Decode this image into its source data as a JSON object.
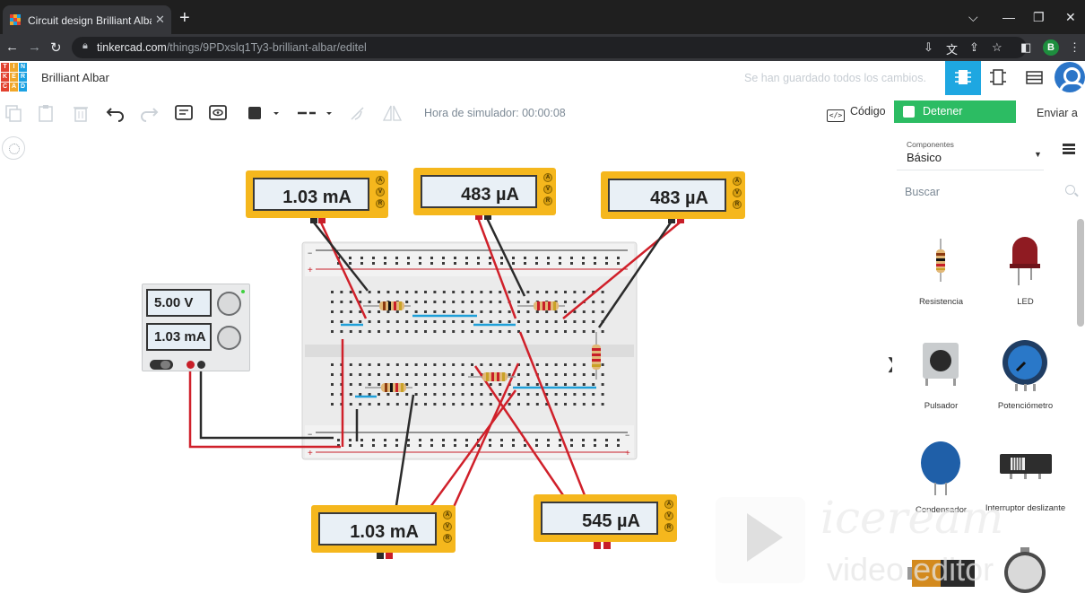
{
  "browser": {
    "tab_title": "Circuit design Brilliant Albar | Tin",
    "url_host": "tinkercad.com",
    "url_path": "/things/9PDxslq1Ty3-brilliant-albar/editel",
    "profile_initial": "B"
  },
  "header": {
    "logo_letters": [
      "T",
      "I",
      "N",
      "K",
      "E",
      "R",
      "C",
      "A",
      "D"
    ],
    "logo_colors": [
      "#e2412f",
      "#f0a72a",
      "#1ba1e2",
      "#e2412f",
      "#f0a72a",
      "#1ba1e2",
      "#e2412f",
      "#f0a72a",
      "#1ba1e2"
    ],
    "project_name": "Brilliant Albar",
    "saved_status": "Se han guardado todos los cambios."
  },
  "toolbar": {
    "sim_time": "Hora de simulador: 00:00:08",
    "code_label": "Código",
    "stop_sim_label": "Detener simulación",
    "send_label": "Enviar a"
  },
  "circuit": {
    "power_supply": {
      "voltage": "5.00 V",
      "current": "1.03 mA"
    },
    "meters": [
      {
        "reading": "1.03 mA"
      },
      {
        "reading": "483 µA"
      },
      {
        "reading": "483 µA"
      },
      {
        "reading": "1.03 mA"
      },
      {
        "reading": "545 µA"
      }
    ],
    "meter_knob_labels": [
      "A",
      "V",
      "R"
    ]
  },
  "panel": {
    "components_label": "Componentes",
    "components_value": "Básico",
    "search_placeholder": "Buscar",
    "parts": [
      {
        "label": "Resistencia",
        "icon": "resistor-icon"
      },
      {
        "label": "LED",
        "icon": "led-icon"
      },
      {
        "label": "Pulsador",
        "icon": "pushbutton-icon"
      },
      {
        "label": "Potenciómetro",
        "icon": "potentiometer-icon"
      },
      {
        "label": "Condensador",
        "icon": "capacitor-icon"
      },
      {
        "label": "Interruptor deslizante",
        "icon": "slide-switch-icon"
      }
    ]
  },
  "colors": {
    "accent_blue": "#1ea7e1",
    "stop_green": "#2cbc63",
    "meter_yellow": "#f5b71d",
    "wire_red": "#d0202a",
    "wire_black": "#2b2b2b"
  }
}
